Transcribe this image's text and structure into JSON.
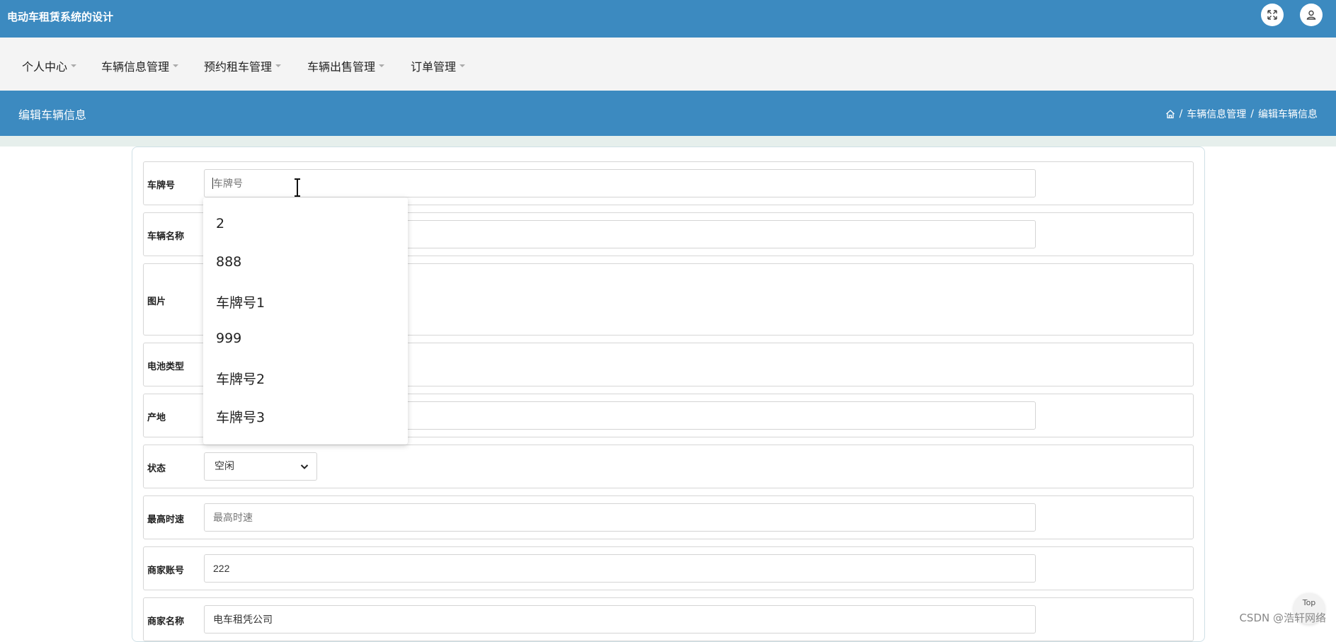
{
  "app": {
    "title": "电动车租赁系统的设计"
  },
  "nav": {
    "items": [
      "个人中心",
      "车辆信息管理",
      "预约租车管理",
      "车辆出售管理",
      "订单管理"
    ]
  },
  "header": {
    "title": "编辑车辆信息",
    "breadcrumb": [
      "车辆信息管理",
      "编辑车辆信息"
    ]
  },
  "form": {
    "plate": {
      "label": "车牌号",
      "placeholder": "车牌号",
      "value": ""
    },
    "name": {
      "label": "车辆名称"
    },
    "image": {
      "label": "图片"
    },
    "battery": {
      "label": "电池类型"
    },
    "origin": {
      "label": "产地"
    },
    "status": {
      "label": "状态",
      "value": "空闲"
    },
    "speed": {
      "label": "最高时速",
      "placeholder": "最高时速"
    },
    "merchant_account": {
      "label": "商家账号",
      "value": "222"
    },
    "merchant_name": {
      "label": "商家名称",
      "value": "电车租凭公司"
    }
  },
  "autocomplete": {
    "options": [
      "2",
      "888",
      "车牌号1",
      "999",
      "车牌号2",
      "车牌号3"
    ]
  },
  "footer": {
    "watermark": "CSDN @浩轩网络",
    "top_label": "Top"
  },
  "colors": {
    "primary": "#3c8ac0",
    "nav_bg": "#f4f4f4"
  },
  "icons": {
    "fullscreen": "expand-icon",
    "user": "user-icon",
    "home": "home-icon"
  }
}
